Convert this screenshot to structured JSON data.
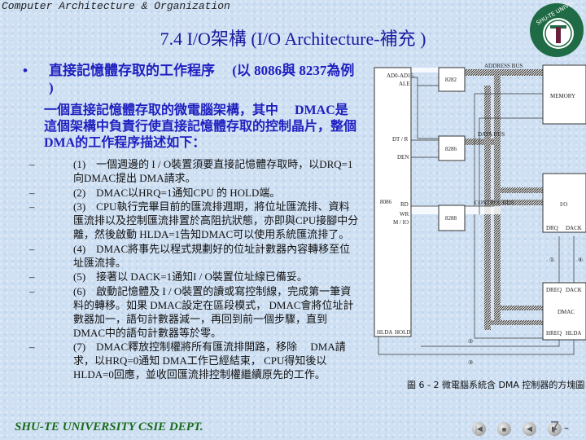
{
  "header": "Computer Architecture & Organization",
  "title": "7.4 I/O架構 (I/O Architecture-補充 )",
  "logo": {
    "text": "SHU-TE UNIVERSITY",
    "letter": "T",
    "color": "#1f6b45"
  },
  "bullet": {
    "heading": "直接記憶體存取的工作程序　 (以 8086與 8237為例 )",
    "intro": "一個直接記憶體存取的微電腦架構，其中　 DMAC是這個架構中負責行使直接記憶體存取的控制晶片，整個 DMA的工作程序描述如下："
  },
  "steps": [
    "(1)　一個週邊的 I / O裝置須要直接記憶體存取時，以DRQ=1向DMAC提出 DMA請求。",
    "(2)　DMAC以HRQ=1通知CPU 的 HOLD端。",
    "(3)　CPU執行完畢目前的匯流排週期，將位址匯流排、資料匯流排以及控制匯流排置於高阻抗狀態，亦即與CPU接腳中分離，然後啟動 HLDA=1告知DMAC可以使用系統匯流排了。",
    "(4)　DMAC將事先以程式規劃好的位址計數器內容轉移至位址匯流排。",
    "(5)　接著以 DACK=1通知I / O裝置位址線已備妥。",
    "(6)　啟動記憶體及 I / O裝置的讀或寫控制線，完成第一筆資料的轉移。如果 DMAC設定在區段模式， DMAC會將位址計數器加一，語句計數器減一，再回到前一個步驟，直到 DMAC中的語句計數器等於零。",
    "(7)　DMAC釋放控制權將所有匯流排開路，移除　 DMA請求，以HRQ=0通知 DMA工作已經結束， CPU得知後以 HLDA=0回應，並收回匯流排控制權繼續原先的工作。"
  ],
  "diagram": {
    "cpu": "8086",
    "latch": "8282",
    "transceiver": "8286",
    "controller": "8288",
    "memory": "MEMORY",
    "io": "I/O",
    "dmac": "DMAC",
    "pins": {
      "ad": "AD0-AD15",
      "ale": "ALE",
      "dtr": "DT / R",
      "den": "DEN",
      "rd": "RD",
      "wr": "WR",
      "mio": "M / IO",
      "hlda": "HLDA",
      "hold": "HOLD"
    },
    "buses": {
      "address": "ADDRESS BUS",
      "data": "DATA BUS",
      "control": "CONTROL BUS"
    },
    "io_pins": {
      "drq": "DRQ",
      "dack": "DACK"
    },
    "dmac_pins": {
      "dreq": "DREQ",
      "dack": "DACK",
      "hreq": "HREQ",
      "hlda": "HLDA"
    },
    "steps_marks": [
      "①",
      "②",
      "③",
      "④"
    ],
    "caption": "圖 6 - 2 微電腦系統含 DMA 控制器的方塊圖"
  },
  "footer": "SHU-TE UNIVERSITY  CSIE DEPT.",
  "nav": [
    "first",
    "stop",
    "previous",
    "next"
  ],
  "page": "7 -"
}
